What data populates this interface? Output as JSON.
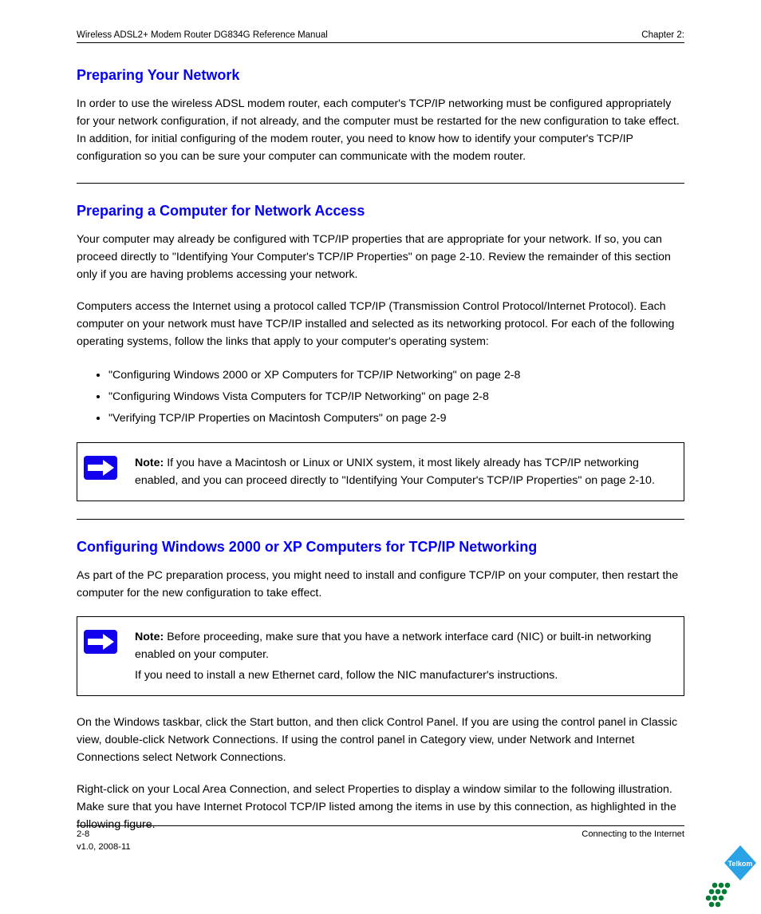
{
  "header": {
    "manual_title": "Wireless ADSL2+ Modem Router DG834G Reference Manual",
    "chapter_tag": "Chapter 2:"
  },
  "sec_a": {
    "heading": "Preparing Your Network",
    "p1": "In order to use the wireless ADSL modem router, each computer's TCP/IP networking must be configured appropriately for your network configuration, if not already, and the computer must be restarted for the new configuration to take effect. In addition, for initial configuring of the modem router, you need to know how to identify your computer's TCP/IP configuration so you can be sure your computer can communicate with the modem router."
  },
  "sec_b": {
    "heading": "Preparing a Computer for Network Access",
    "p1": "Your computer may already be configured with TCP/IP properties that are appropriate for your network. If so, you can proceed directly to \"Identifying Your Computer's TCP/IP Properties\" on page 2-10. Review the remainder of this section only if you are having problems accessing your network.",
    "p2": "Computers access the Internet using a protocol called TCP/IP (Transmission Control Protocol/Internet Protocol). Each computer on your network must have TCP/IP installed and selected as its networking protocol. For each of the following operating systems, follow the links that apply to your computer's operating system:",
    "bullets": [
      "\"Configuring Windows 2000 or XP Computers for TCP/IP Networking\" on page 2-8",
      "\"Configuring Windows Vista Computers for TCP/IP Networking\" on page 2-8",
      "\"Verifying TCP/IP Properties on Macintosh Computers\" on page 2-9"
    ],
    "note": "If you have a Macintosh or Linux or UNIX system, it most likely already has TCP/IP networking enabled, and you can proceed directly to \"Identifying Your Computer's TCP/IP Properties\" on page 2-10."
  },
  "sec_c": {
    "heading": "Configuring Windows 2000 or XP Computers for TCP/IP Networking",
    "p1": "As part of the PC preparation process, you might need to install and configure TCP/IP on your computer, then restart the computer for the new configuration to take effect.",
    "note_label": "Note:",
    "note_body": "Before proceeding, make sure that you have a network interface card (NIC) or built-in networking enabled on your computer.",
    "note_extra": "If you need to install a new Ethernet card, follow the NIC manufacturer's instructions.",
    "p2": "On the Windows taskbar, click the Start button, and then click Control Panel. If you are using the control panel in Classic view, double-click Network Connections. If using the control panel in Category view, under Network and Internet Connections select Network Connections.",
    "p3": "Right-click on your Local Area Connection, and select Properties to display a window similar to the following illustration. Make sure that you have Internet Protocol TCP/IP listed among the items in use by this connection, as highlighted in the following figure."
  },
  "footer": {
    "left": "2-8",
    "right": "Connecting to the Internet",
    "line2_left": "v1.0, 2008-11"
  },
  "note_label": "Note:"
}
